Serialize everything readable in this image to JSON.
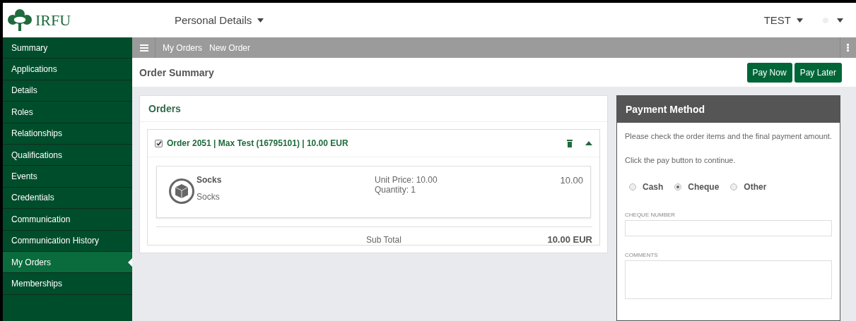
{
  "header": {
    "logo_text": "IRFU",
    "menu": "Personal Details",
    "user": "TEST"
  },
  "sidebar": {
    "items": [
      {
        "label": "Summary",
        "selected": false
      },
      {
        "label": "Applications",
        "selected": false
      },
      {
        "label": "Details",
        "selected": false
      },
      {
        "label": "Roles",
        "selected": false
      },
      {
        "label": "Relationships",
        "selected": false
      },
      {
        "label": "Qualifications",
        "selected": false
      },
      {
        "label": "Events",
        "selected": false
      },
      {
        "label": "Credentials",
        "selected": false
      },
      {
        "label": "Communication",
        "selected": false
      },
      {
        "label": "Communication History",
        "selected": false
      },
      {
        "label": "My Orders",
        "selected": true
      },
      {
        "label": "Memberships",
        "selected": false
      }
    ]
  },
  "toolbar": {
    "breadcrumbs": [
      "My Orders",
      "New Order"
    ]
  },
  "page": {
    "title": "Order Summary",
    "buttons": [
      "Pay Now",
      "Pay Later"
    ]
  },
  "orders": {
    "title": "Orders",
    "order": {
      "checked": true,
      "expanded": true,
      "label": "Order 2051 | Max Test (16795101) | 10.00 EUR",
      "items": [
        {
          "name": "Socks",
          "description": "Socks",
          "unit_price": "Unit Price: 10.00",
          "quantity": "Quantity: 1",
          "amount": "10.00"
        }
      ],
      "subtotal_label": "Sub Total",
      "subtotal": "10.00 EUR"
    }
  },
  "payment": {
    "title": "Payment Method",
    "paragraphs": [
      "Please check the order items and the final payment amount.",
      "Click the pay button to continue."
    ],
    "options": [
      {
        "label": "Cash",
        "selected": false
      },
      {
        "label": "Cheque",
        "selected": true
      },
      {
        "label": "Other",
        "selected": false
      }
    ],
    "fields": [
      {
        "label": "CHEQUE NUMBER",
        "kind": "input"
      },
      {
        "label": "COMMENTS",
        "kind": "textarea"
      }
    ]
  }
}
